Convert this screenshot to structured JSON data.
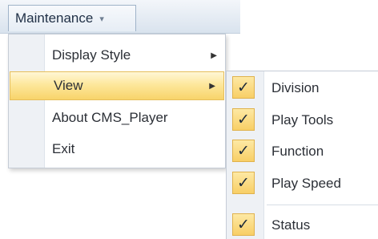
{
  "menubar": {
    "menu_label": "Maintenance",
    "caret": "▾"
  },
  "main_menu": {
    "items": [
      {
        "label": "Display Style",
        "has_submenu": true,
        "icon": "chevron-right-icon"
      },
      {
        "label": "View",
        "has_submenu": true,
        "highlighted": true,
        "icon": "chevron-right-icon"
      },
      {
        "label": "About CMS_Player",
        "has_submenu": false
      },
      {
        "label": "Exit",
        "has_submenu": false
      }
    ],
    "arrow_glyph": "▶",
    "highlight_color": "#fbe08f"
  },
  "view_submenu": {
    "check_glyph": "✓",
    "items": [
      {
        "label": "Division",
        "checked": true
      },
      {
        "label": "Play Tools",
        "checked": true
      },
      {
        "label": "Function",
        "checked": true
      },
      {
        "label": "Play Speed",
        "checked": true
      },
      {
        "label": "Status",
        "checked": true
      }
    ]
  }
}
